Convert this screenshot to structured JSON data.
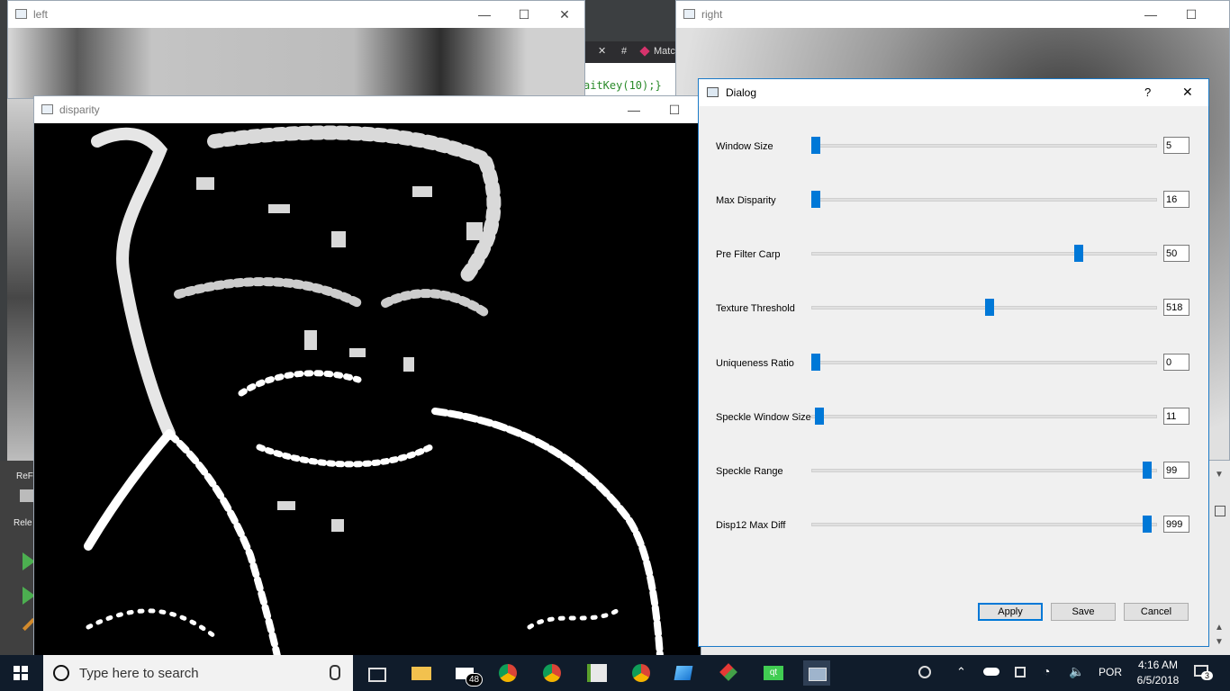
{
  "windows": {
    "left": {
      "title": "left"
    },
    "right": {
      "title": "right"
    },
    "disparity": {
      "title": "disparity"
    }
  },
  "editor_fragment": {
    "tab_hash": "#",
    "tab_label": "Matc",
    "code_line": "aitKey(10);}"
  },
  "ide_fragment": {
    "label_1": "ReF",
    "label_2": "Rele"
  },
  "dialog": {
    "title": "Dialog",
    "help": "?",
    "close": "✕",
    "sliders": [
      {
        "label": "Window Size",
        "value": "5",
        "pos": 0.0
      },
      {
        "label": "Max Disparity",
        "value": "16",
        "pos": 0.0
      },
      {
        "label": "Pre Filter Carp",
        "value": "50",
        "pos": 0.78
      },
      {
        "label": "Texture Threshold",
        "value": "518",
        "pos": 0.515
      },
      {
        "label": "Uniqueness Ratio",
        "value": "0",
        "pos": 0.0
      },
      {
        "label": "Speckle Window Size",
        "value": "11",
        "pos": 0.01
      },
      {
        "label": "Speckle Range",
        "value": "99",
        "pos": 0.985
      },
      {
        "label": "Disp12 Max Diff",
        "value": "999",
        "pos": 0.985
      }
    ],
    "buttons": {
      "apply": "Apply",
      "save": "Save",
      "cancel": "Cancel"
    },
    "accent": "#0078d7"
  },
  "taskbar": {
    "search_placeholder": "Type here to search",
    "mail_badge": "48",
    "language": "POR",
    "time": "4:16 AM",
    "date": "6/5/2018",
    "notification_count": "3"
  }
}
